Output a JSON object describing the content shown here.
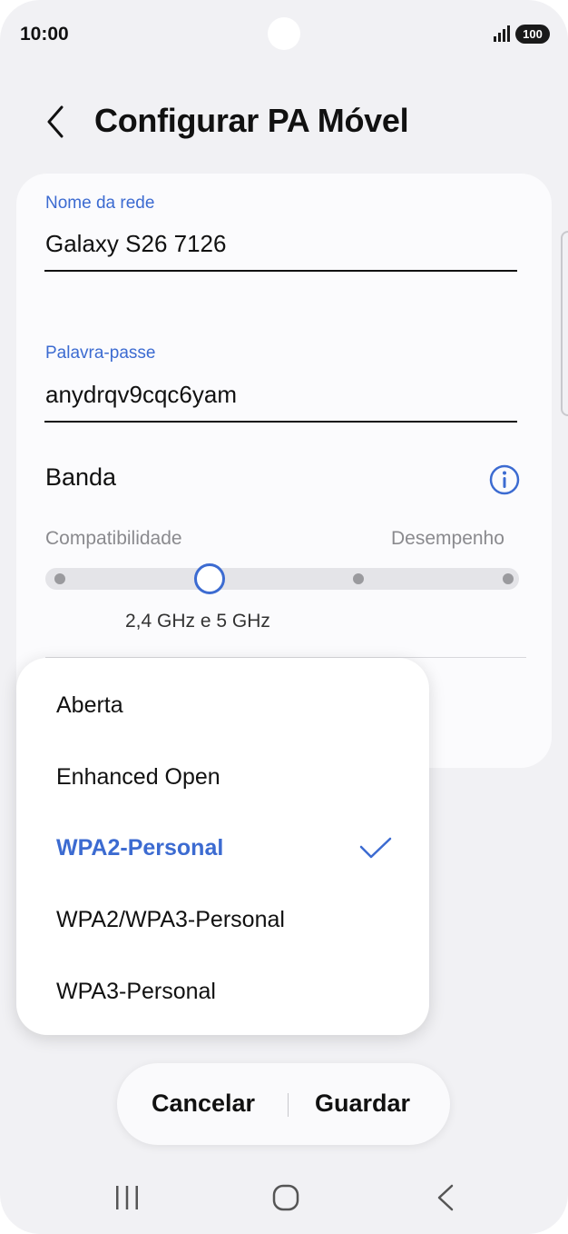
{
  "status_bar": {
    "time": "10:00",
    "battery": "100",
    "signal_icon": "signal-icon"
  },
  "header": {
    "title": "Configurar PA Móvel",
    "back_icon": "back-chevron-icon"
  },
  "form": {
    "network_name": {
      "label": "Nome da rede",
      "value": "Galaxy S26 7126"
    },
    "password": {
      "label": "Palavra-passe",
      "value": "anydrqv9cqc6yam"
    },
    "band": {
      "label": "Banda",
      "info_icon": "info-icon",
      "left_label": "Compatibilidade",
      "right_label": "Desempenho",
      "value_label": "2,4 GHz e 5 GHz",
      "step_count": 4,
      "selected_step": 2
    }
  },
  "security_menu": {
    "options": [
      {
        "label": "Aberta",
        "selected": false
      },
      {
        "label": "Enhanced Open",
        "selected": false
      },
      {
        "label": "WPA2-Personal",
        "selected": true
      },
      {
        "label": "WPA2/WPA3-Personal",
        "selected": false
      },
      {
        "label": "WPA3-Personal",
        "selected": false
      }
    ],
    "check_icon": "check-icon"
  },
  "actions": {
    "cancel": "Cancelar",
    "save": "Guardar"
  },
  "nav_bar": {
    "recents_icon": "recents-icon",
    "home_icon": "home-icon",
    "back_icon": "nav-back-icon"
  },
  "colors": {
    "accent": "#3c6bd1",
    "background": "#f1f1f4",
    "card": "#fbfbfd"
  }
}
